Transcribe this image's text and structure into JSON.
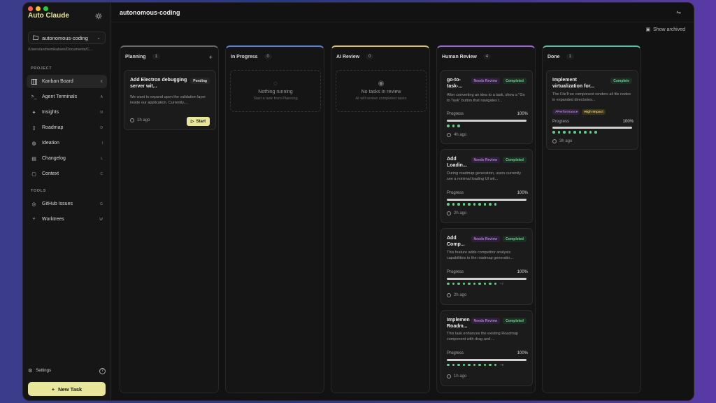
{
  "app": {
    "title": "Auto Claude"
  },
  "sidebar": {
    "project_selector": "autonomous-coding",
    "path": "/Users/andremikalsen/Documents/C...",
    "project_section": "PROJECT",
    "tools_section": "TOOLS",
    "items": [
      {
        "label": "Kanban Board",
        "key": "K",
        "icon": "kanban-icon"
      },
      {
        "label": "Agent Terminals",
        "key": "A",
        "icon": "terminal-icon"
      },
      {
        "label": "Insights",
        "key": "N",
        "icon": "sparkles-icon"
      },
      {
        "label": "Roadmap",
        "key": "D",
        "icon": "map-icon"
      },
      {
        "label": "Ideation",
        "key": "I",
        "icon": "lightbulb-icon"
      },
      {
        "label": "Changelog",
        "key": "L",
        "icon": "changelog-icon"
      },
      {
        "label": "Context",
        "key": "C",
        "icon": "book-icon"
      }
    ],
    "tools": [
      {
        "label": "GitHub Issues",
        "key": "G",
        "icon": "github-icon"
      },
      {
        "label": "Worktrees",
        "key": "W",
        "icon": "git-branch-icon"
      }
    ],
    "settings_label": "Settings",
    "new_task_label": "New Task"
  },
  "header": {
    "project_title": "autonomous-coding",
    "show_archived": "Show archived"
  },
  "colors": {
    "accent": "#e7e69b",
    "planning": "#7a7a7a",
    "in_progress": "#5a84d8",
    "ai_review": "#d8c65a",
    "human_review": "#9a6ad8",
    "done": "#4fc0a0"
  },
  "columns": [
    {
      "title": "Planning",
      "count": "1"
    },
    {
      "title": "In Progress",
      "count": "0",
      "empty_title": "Nothing running",
      "empty_sub": "Start a task from Planning"
    },
    {
      "title": "AI Review",
      "count": "0",
      "empty_title": "No tasks in review",
      "empty_sub": "AI will review completed tasks"
    },
    {
      "title": "Human Review",
      "count": "4"
    },
    {
      "title": "Done",
      "count": "1"
    }
  ],
  "planning_card": {
    "title": "Add Electron debugging server wit...",
    "badge": "Pending",
    "desc": "We want to expand upon the validation layer inside our application. Currently,...",
    "time": "1h ago",
    "start_label": "Start"
  },
  "human_review_cards": [
    {
      "title": "go-to-task-...",
      "badge1": "Needs Review",
      "badge2": "Completed",
      "desc": "After converting an idea to a task, show a \"Go to Task\" button that navigates t...",
      "progress_label": "Progress",
      "progress": "100%",
      "progress_fraction": 1.0,
      "dots": 3,
      "more": "",
      "time": "4h ago"
    },
    {
      "title": "Add Loadin...",
      "badge1": "Needs Review",
      "badge2": "Completed",
      "desc": "During roadmap generation, users currently see a minimal loading UI wit...",
      "progress_label": "Progress",
      "progress": "100%",
      "progress_fraction": 1.0,
      "dots": 10,
      "more": "",
      "time": "2h ago"
    },
    {
      "title": "Add Comp...",
      "badge1": "Needs Review",
      "badge2": "Completed",
      "desc": "This feature adds competitor analysis capabilities to the roadmap generatio...",
      "progress_label": "Progress",
      "progress": "100%",
      "progress_fraction": 1.0,
      "dots": 10,
      "more": "+7",
      "time": "2h ago"
    },
    {
      "title": "Implemen Roadm...",
      "badge1": "Needs Review",
      "badge2": "Completed",
      "desc": "This task enhances the existing Roadmap component with drag-and-...",
      "progress_label": "Progress",
      "progress": "100%",
      "progress_fraction": 1.0,
      "dots": 10,
      "more": "+8",
      "time": "1h ago"
    }
  ],
  "done_card": {
    "title": "Implement virtualization for...",
    "badge": "Complete",
    "desc": "The FileTree component renders all file nodes in expanded directories...",
    "tag1": "Performance",
    "tag2": "High Impact",
    "progress_label": "Progress",
    "progress": "100%",
    "progress_fraction": 1.0,
    "dots": 9,
    "time": "3h ago"
  }
}
